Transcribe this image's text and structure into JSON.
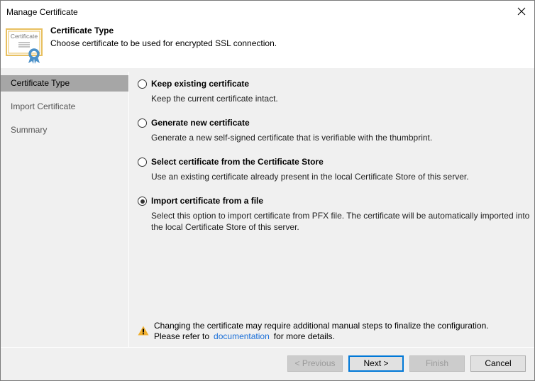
{
  "window": {
    "title": "Manage Certificate"
  },
  "header": {
    "icon": "certificate-icon",
    "icon_text": "Certificate",
    "title": "Certificate Type",
    "subtitle": "Choose certificate to be used for encrypted SSL connection."
  },
  "sidebar": {
    "items": [
      {
        "label": "Certificate Type",
        "active": true
      },
      {
        "label": "Import Certificate",
        "active": false
      },
      {
        "label": "Summary",
        "active": false
      }
    ]
  },
  "options": [
    {
      "label": "Keep existing certificate",
      "description": "Keep the current certificate intact.",
      "selected": false
    },
    {
      "label": "Generate new certificate",
      "description": "Generate a new self-signed certificate that is verifiable with the thumbprint.",
      "selected": false
    },
    {
      "label": "Select certificate from the Certificate Store",
      "description": "Use an existing certificate already present in the local Certificate Store of this server.",
      "selected": false
    },
    {
      "label": "Import certificate from a file",
      "description": "Select this option to import certificate from PFX file. The certificate will be automatically imported into the local Certificate Store of this server.",
      "selected": true
    }
  ],
  "warning": {
    "icon": "warning-icon",
    "line1": "Changing the certificate may require additional manual steps to finalize the configuration.",
    "line2_prefix": "Please refer to",
    "link": "documentation",
    "line2_suffix": "for more details."
  },
  "buttons": {
    "previous": "< Previous",
    "next": "Next >",
    "finish": "Finish",
    "cancel": "Cancel"
  },
  "colors": {
    "accent": "#0078d7",
    "link": "#1a6fd8",
    "sidebar_active": "#a6a6a6",
    "warning": "#f0b030",
    "certificate_border": "#e8c060",
    "ribbon": "#4a90c8"
  }
}
